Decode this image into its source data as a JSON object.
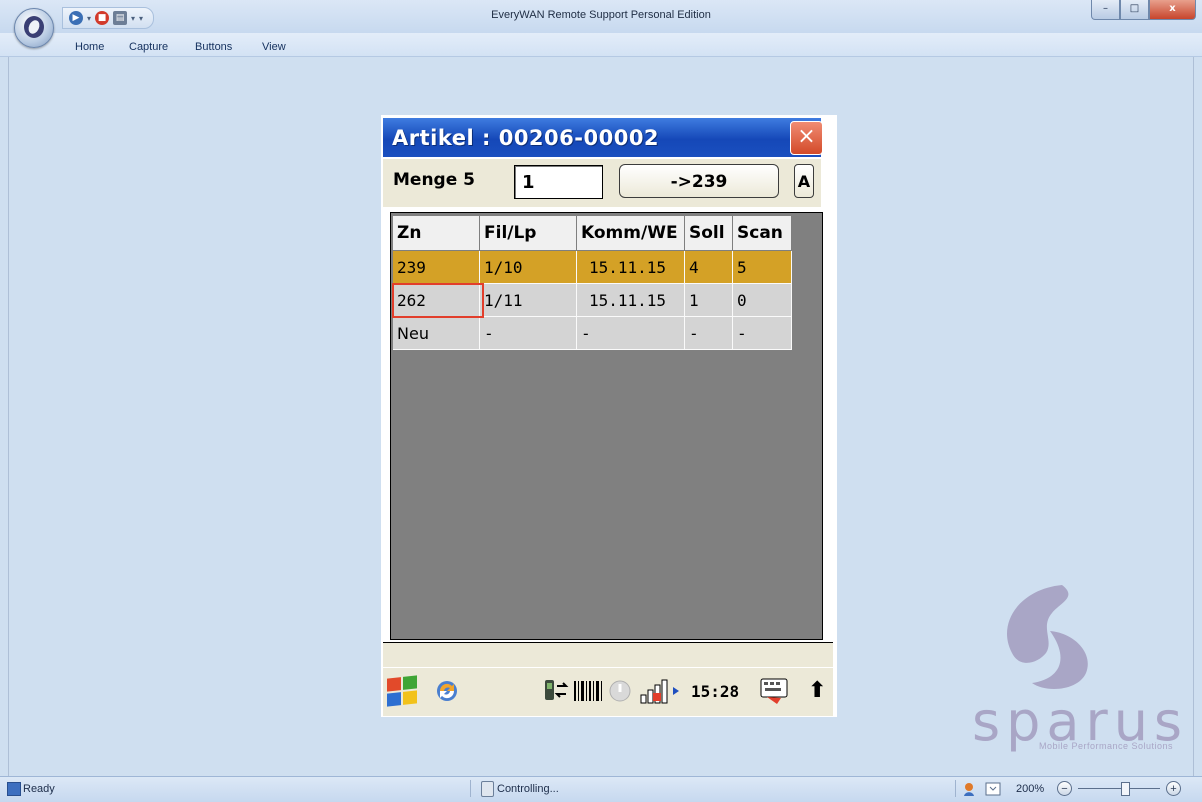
{
  "window": {
    "title": "EveryWAN Remote Support Personal Edition",
    "controls": {
      "minimize": "–",
      "maximize": "□",
      "close": "x"
    }
  },
  "quick_access": {
    "dropdown_arrow": "▾"
  },
  "menu": [
    "Home",
    "Capture",
    "Buttons",
    "View"
  ],
  "device": {
    "title": "Artikel : 00206-00002",
    "close_glyph": "×",
    "menge_label": "Menge 5",
    "quantity_value": "1",
    "next_button": "->239",
    "a_button": "A",
    "table": {
      "headers": [
        "Zn",
        "Fil/Lp",
        "Komm/WE",
        "Soll",
        "Scan"
      ],
      "rows": [
        [
          "239",
          "1/10",
          "15.11.15",
          "4",
          "5"
        ],
        [
          "262",
          "1/11",
          "15.11.15",
          "1",
          "0"
        ],
        [
          "Neu",
          "-",
          "-",
          "-",
          "-"
        ]
      ],
      "selected_row": 0,
      "focused_cell": "262"
    },
    "taskbar": {
      "clock": "15:28",
      "up_arrow": "⬆"
    },
    "icons": [
      "windows-start-icon",
      "sync-icon",
      "connection-icon",
      "barcode-icon",
      "power-icon",
      "signal-icon",
      "keyboard-icon"
    ]
  },
  "watermark": {
    "brand": "sparus",
    "tagline": "Mobile Performance Solutions"
  },
  "statusbar": {
    "ready": "Ready",
    "controlling": "Controlling...",
    "zoom": "200%",
    "zoom_out": "−",
    "zoom_in": "+"
  },
  "colors": {
    "selected_row": "#d4a126",
    "title_blue": "#1548b8",
    "focus_border": "#e23e2b",
    "grid_background": "#808080"
  }
}
